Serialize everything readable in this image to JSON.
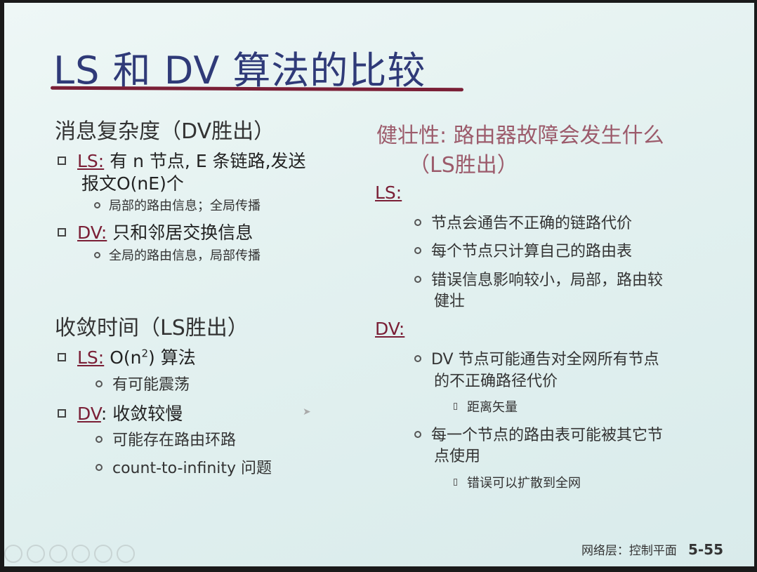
{
  "title": "LS 和 DV 算法的比较",
  "left": {
    "msg_heading": "消息复杂度（DV胜出）",
    "ls_label": "LS:",
    "ls_text": "有 n 节点, E 条链路,发送",
    "ls_text2": "报文O(nE)个",
    "ls_sub": "局部的路由信息；全局传播",
    "dv_label": "DV:",
    "dv_text": "只和邻居交换信息",
    "dv_sub": "全局的路由信息，局部传播",
    "conv_heading": "收敛时间（LS胜出）",
    "conv_ls_label": "LS:",
    "conv_ls_text_pre": "O(n",
    "conv_ls_sup": "2",
    "conv_ls_text_post": ") 算法",
    "conv_ls_sub": "有可能震荡",
    "conv_dv_label": "DV",
    "conv_dv_text": ": 收敛较慢",
    "conv_dv_sub1": "可能存在路由环路",
    "conv_dv_sub2": "count-to-infinity 问题"
  },
  "right": {
    "robust_heading": "健壮性: 路由器故障会发生什么",
    "robust_heading2": "（LS胜出）",
    "ls_label": "LS:",
    "ls_items": [
      "节点会通告不正确的链路代价",
      "每个节点只计算自己的路由表",
      "错误信息影响较小，局部，路由较",
      "健壮"
    ],
    "dv_label": "DV:",
    "dv_item1": "DV 节点可能通告对全网所有节点",
    "dv_item1b": "的不正确路径代价",
    "dv_item1_sub": "距离矢量",
    "dv_item2": "每一个节点的路由表可能被其它节",
    "dv_item2b": "点使用",
    "dv_item2_sub": "错误可以扩散到全网"
  },
  "footer": {
    "section": "网络层：控制平面",
    "page": "5-55"
  }
}
